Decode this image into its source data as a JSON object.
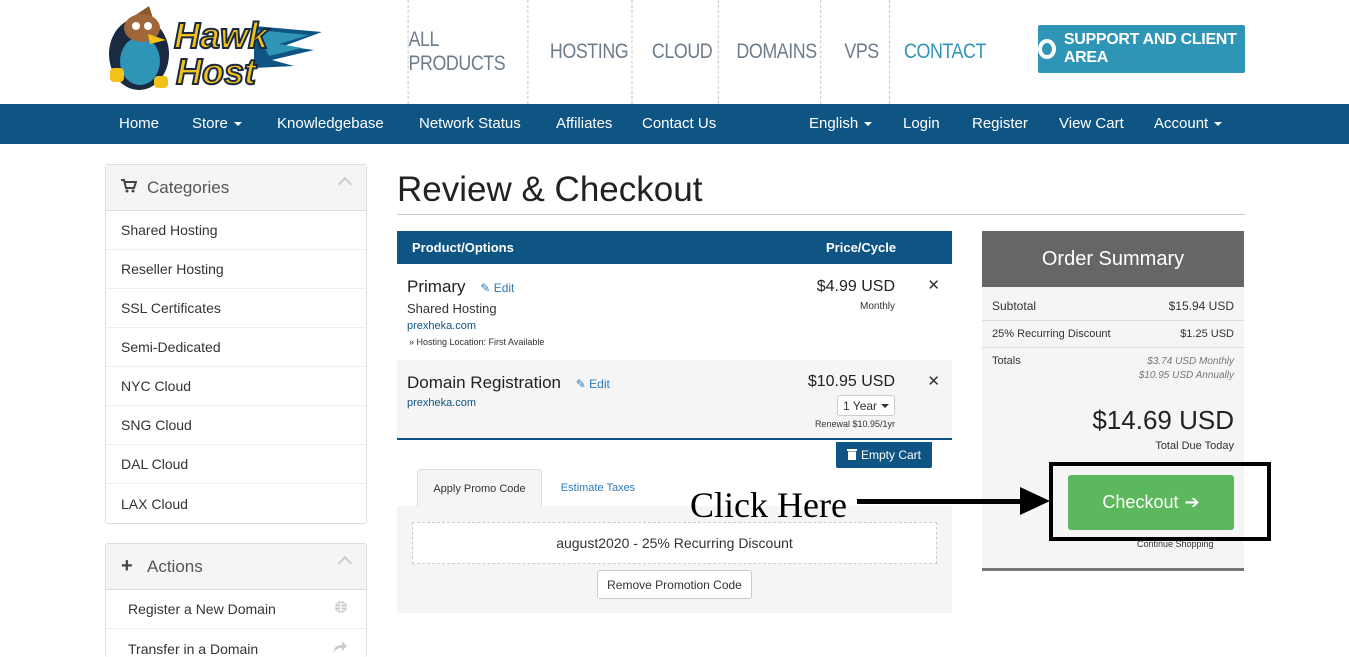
{
  "brand": {
    "logo_text": "HawkHost"
  },
  "top_nav": {
    "items": [
      {
        "label": "ALL PRODUCTS"
      },
      {
        "label": "HOSTING"
      },
      {
        "label": "CLOUD"
      },
      {
        "label": "DOMAINS"
      },
      {
        "label": "VPS"
      },
      {
        "label": "CONTACT"
      }
    ],
    "support_button": "SUPPORT AND CLIENT AREA"
  },
  "navbar": {
    "home": "Home",
    "store": "Store",
    "knowledgebase": "Knowledgebase",
    "network_status": "Network Status",
    "affiliates": "Affiliates",
    "contact_us": "Contact Us",
    "language": "English",
    "login": "Login",
    "register": "Register",
    "view_cart": "View Cart",
    "account": "Account"
  },
  "sidebar": {
    "categories_title": "Categories",
    "categories": [
      "Shared Hosting",
      "Reseller Hosting",
      "SSL Certificates",
      "Semi-Dedicated",
      "NYC Cloud",
      "SNG Cloud",
      "DAL Cloud",
      "LAX Cloud"
    ],
    "actions_title": "Actions",
    "actions": [
      {
        "label": "Register a New Domain",
        "icon": "globe-icon"
      },
      {
        "label": "Transfer in a Domain",
        "icon": "share-arrow-icon"
      }
    ]
  },
  "page": {
    "title": "Review & Checkout"
  },
  "cart": {
    "col_product": "Product/Options",
    "col_price": "Price/Cycle",
    "edit_label": "Edit",
    "items": [
      {
        "name": "Primary",
        "group": "Shared Hosting",
        "domain": "prexheka.com",
        "note": "» Hosting Location: First Available",
        "price": "$4.99 USD",
        "cycle": "Monthly"
      },
      {
        "name": "Domain Registration",
        "domain": "prexheka.com",
        "price": "$10.95 USD",
        "period": "1 Year",
        "renewal": "Renewal $10.95/1yr"
      }
    ],
    "empty_cart": "Empty Cart"
  },
  "promo": {
    "tab_apply": "Apply Promo Code",
    "tab_taxes": "Estimate Taxes",
    "applied": "august2020 - 25% Recurring Discount",
    "remove_button": "Remove Promotion Code"
  },
  "summary": {
    "title": "Order Summary",
    "subtotal_label": "Subtotal",
    "subtotal_value": "$15.94 USD",
    "discount_label": "25% Recurring Discount",
    "discount_value": "$1.25 USD",
    "totals_label": "Totals",
    "totals_monthly": "$3.74 USD Monthly",
    "totals_annually": "$10.95 USD Annually",
    "total_due": "$14.69 USD",
    "total_due_label": "Total Due Today",
    "checkout": "Checkout",
    "continue": "Continue Shopping"
  },
  "annotation": {
    "text": "Click Here"
  },
  "colors": {
    "navbar": "#0e5584",
    "accent": "#2e95b7",
    "checkout": "#5cb85c"
  }
}
